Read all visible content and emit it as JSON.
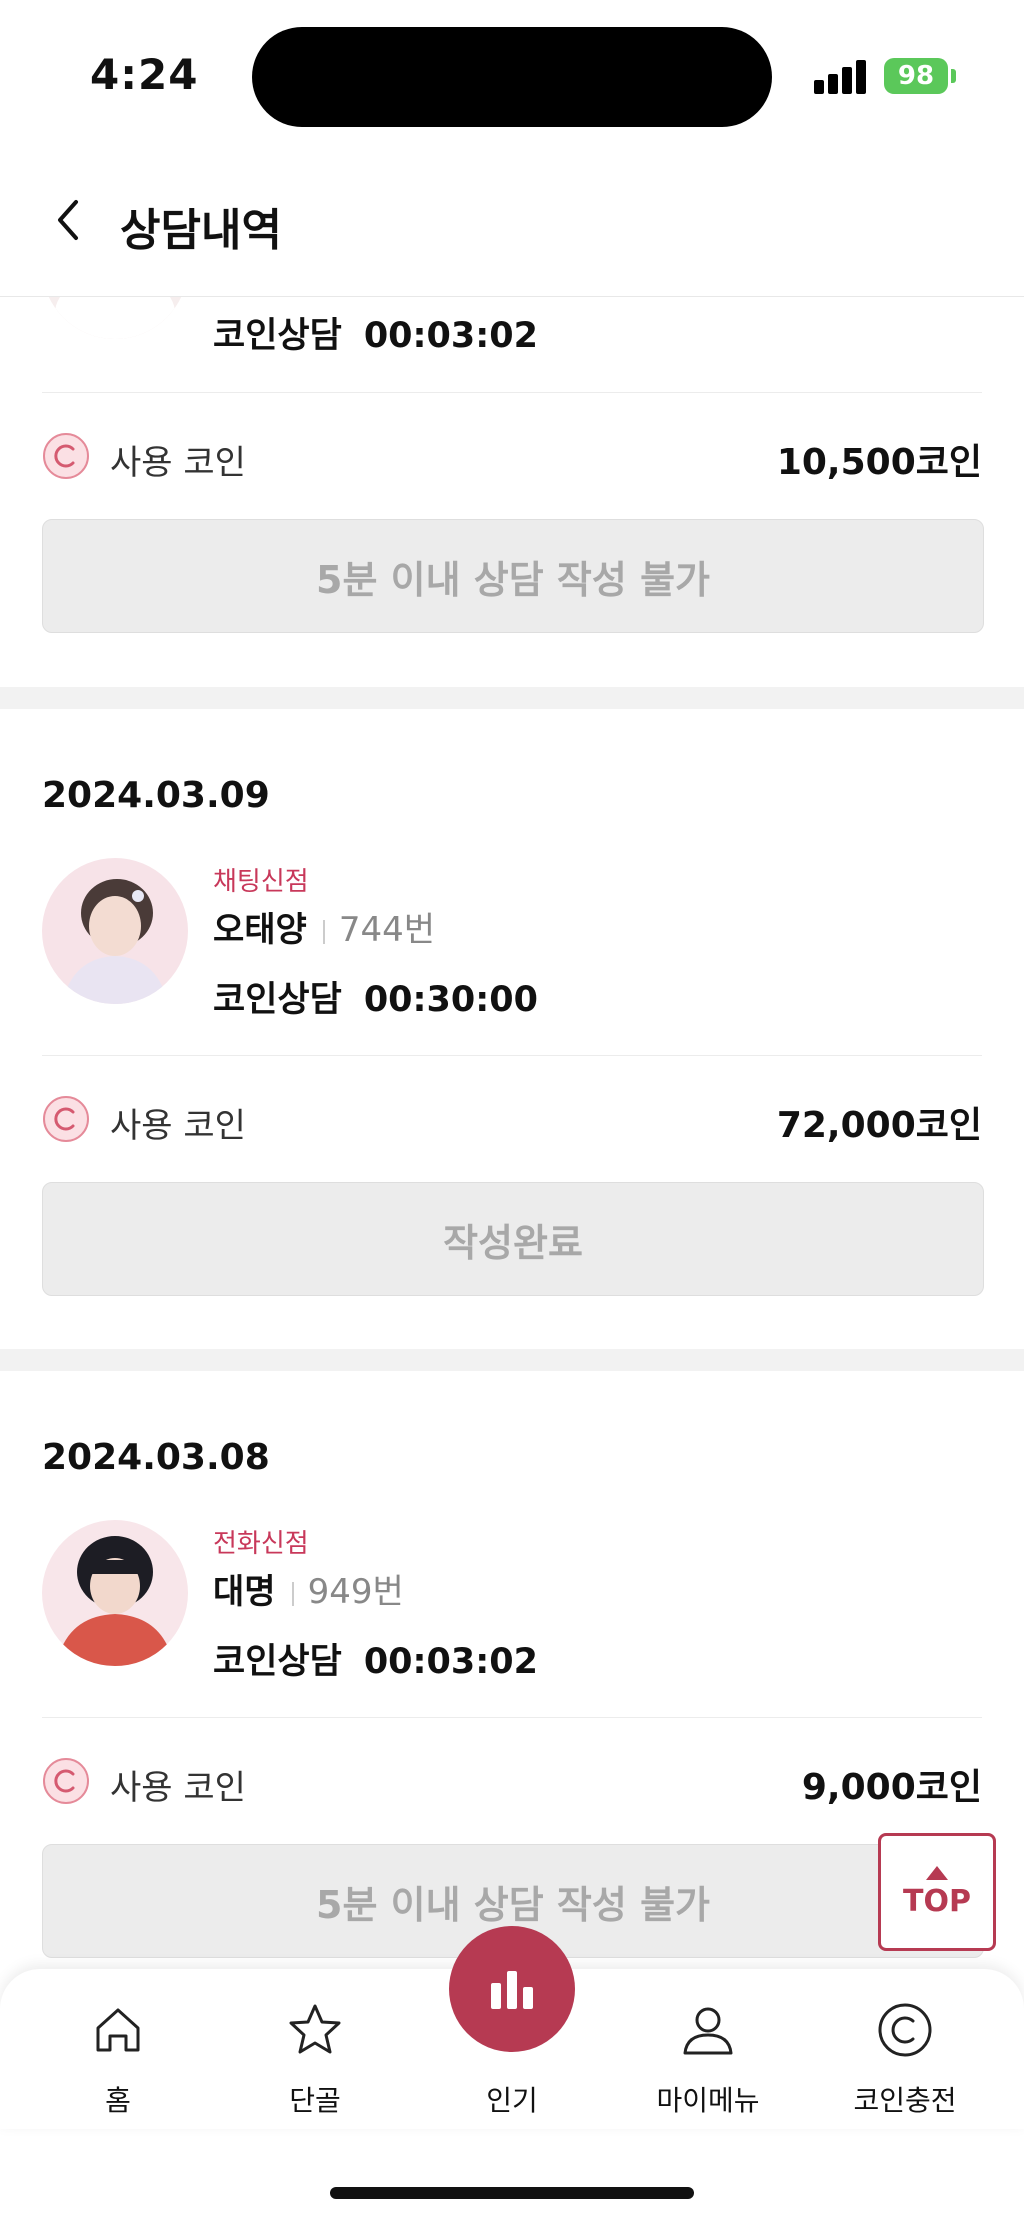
{
  "status": {
    "time": "4:24",
    "battery": "98"
  },
  "header": {
    "title": "상담내역"
  },
  "records": [
    {
      "date": "",
      "category": "",
      "name": "",
      "number": "",
      "type": "코인상담",
      "duration": "00:03:02",
      "coin_label": "사용 코인",
      "coin_amount": "10,500코인",
      "button": "5분 이내 상담 작성 불가"
    },
    {
      "date": "2024.03.09",
      "category": "채팅신점",
      "name": "오태양",
      "number": "744번",
      "type": "코인상담",
      "duration": "00:30:00",
      "coin_label": "사용 코인",
      "coin_amount": "72,000코인",
      "button": "작성완료"
    },
    {
      "date": "2024.03.08",
      "category": "전화신점",
      "name": "대명",
      "number": "949번",
      "type": "코인상담",
      "duration": "00:03:02",
      "coin_label": "사용 코인",
      "coin_amount": "9,000코인",
      "button": "5분 이내 상담 작성 불가"
    }
  ],
  "top_button": "TOP",
  "tabs": [
    {
      "label": "홈",
      "icon": "home-icon"
    },
    {
      "label": "단골",
      "icon": "star-icon"
    },
    {
      "label": "인기",
      "icon": "bar-chart-icon"
    },
    {
      "label": "마이메뉴",
      "icon": "person-icon"
    },
    {
      "label": "코인충전",
      "icon": "coin-icon"
    }
  ],
  "colors": {
    "accent": "#b63a52",
    "category": "#c8385a",
    "disabled_button": "#ececec"
  }
}
